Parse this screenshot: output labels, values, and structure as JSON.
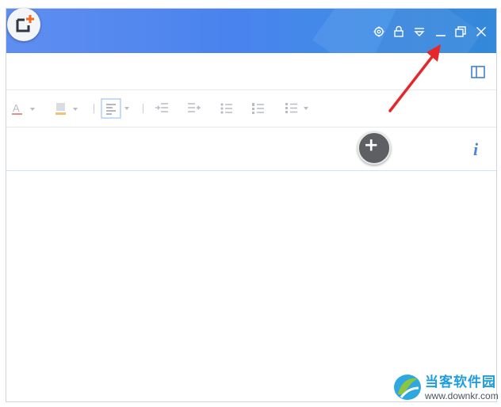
{
  "app": {
    "title_bar": {
      "controls": [
        "settings-icon",
        "lock-icon",
        "dropdown-filter-icon",
        "minimize-icon",
        "restore-icon",
        "close-icon"
      ]
    },
    "toolbar": {
      "items": [
        "font-color-icon",
        "highlight-color-icon",
        "align-left-icon",
        "indent-increase-icon",
        "indent-decrease-icon",
        "bulleted-list-icon",
        "numbered-list-icon",
        "line-spacing-icon"
      ]
    },
    "info_icon": "i"
  },
  "watermark": {
    "name": "当客软件园",
    "url": "www.downkr.com"
  },
  "colors": {
    "titlebar": "#4a83ee",
    "accent": "#4a86d8",
    "arrow": "#e8262a",
    "plus_button": "#5d5f62"
  }
}
